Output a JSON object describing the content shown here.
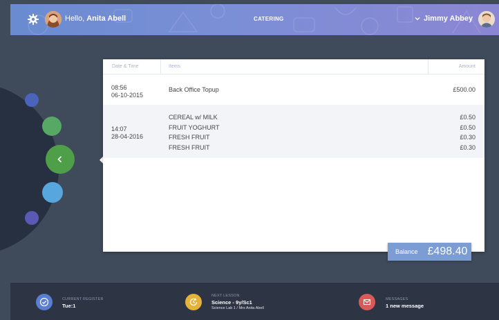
{
  "header": {
    "greeting_prefix": "Hello, ",
    "greeting_name": "Anita Abell",
    "app_title": "CATERING",
    "user_name": "Jimmy Abbey",
    "gradient": [
      "#6a8bd0",
      "#8b86d3"
    ]
  },
  "icons": {
    "settings": "gear-icon",
    "back": "chevron-left-icon",
    "user_menu": "chevron-down-icon",
    "register": "check-circle-icon",
    "lesson": "refresh-clock-icon",
    "messages": "envelope-icon"
  },
  "table": {
    "columns": [
      "Date & Time",
      "Items",
      "Amount"
    ],
    "rows": [
      {
        "time": "08:56",
        "date": "06-10-2015",
        "items": [
          "Back Office Topup"
        ],
        "amounts": [
          "£500.00"
        ]
      },
      {
        "time": "14:07",
        "date": "28-04-2016",
        "items": [
          "CEREAL w/ MILK",
          "FRUIT YOGHURT",
          "FRESH FRUIT",
          "FRESH FRUIT"
        ],
        "amounts": [
          "£0.50",
          "£0.50",
          "£0.30",
          "£0.30"
        ]
      }
    ]
  },
  "balance": {
    "label": "Balance",
    "value": "£498.40"
  },
  "footer": {
    "register": {
      "label": "CURRENT REGISTER",
      "value": "Tue:1",
      "color": "#5a7fd1"
    },
    "lesson": {
      "label": "NEXT LESSON",
      "value": "Science - 9y/Sc1",
      "sub": "Science Lab 1 / Mrs Anita Abell",
      "color": "#e6b23a"
    },
    "messages": {
      "label": "MESSAGES",
      "value": "1 new message",
      "color": "#d95a59"
    }
  },
  "colors": {
    "background": "#3f4a5b",
    "arc": "#273041",
    "back_button": "#4f9e48",
    "dots": [
      "#4b63bb",
      "#57a864",
      "#58a6de",
      "#5a5ab5"
    ],
    "balance": "#7b9dd4"
  }
}
